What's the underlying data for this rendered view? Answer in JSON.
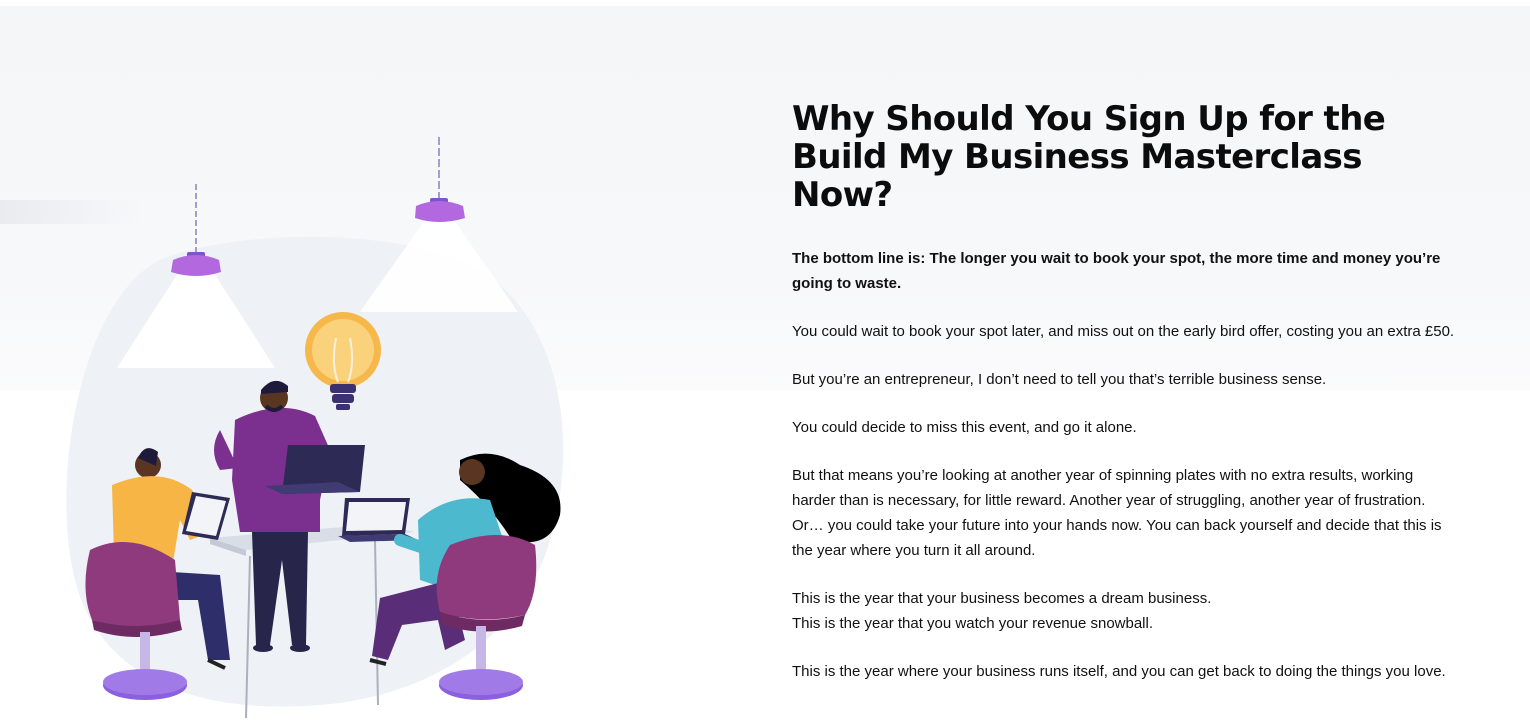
{
  "section": {
    "headline": "Why Should You Sign Up for the Build My Business Masterclass Now?",
    "paragraphs": [
      {
        "style": "bold",
        "lines": [
          "The bottom line is: The longer you wait to book your spot, the more time and money you’re going to waste."
        ]
      },
      {
        "style": "normal",
        "lines": [
          "You could wait to book your spot later, and miss out on the early bird offer, costing you an extra £50."
        ]
      },
      {
        "style": "normal",
        "lines": [
          "But you’re an entrepreneur, I don’t need to tell you that’s terrible business sense."
        ]
      },
      {
        "style": "normal",
        "lines": [
          "You could decide to miss this event, and go it alone."
        ]
      },
      {
        "style": "normal",
        "lines": [
          "But that means you’re looking at another year of spinning plates with no extra results, working harder than is necessary, for little reward. Another year of struggling, another year of frustration. Or… you could take your future into your hands now. You can back yourself and decide that this is the year where you turn it all around."
        ]
      },
      {
        "style": "normal",
        "lines": [
          "This is the year that your business becomes a dream business.",
          "This is the year that you watch your revenue snowball."
        ]
      },
      {
        "style": "normal",
        "lines": [
          "This is the year where your business runs itself, and you can get back to doing the things you love."
        ]
      }
    ]
  },
  "illustration": {
    "icons": [
      "ceiling-lamp-icon",
      "lightbulb-icon",
      "laptop-icon",
      "tablet-icon",
      "chair-icon"
    ],
    "colors": {
      "purple": "#7b2f8f",
      "chair": "#8e3a7d",
      "yellow": "#f6b544",
      "teal": "#4cb9cf",
      "navy": "#27264a",
      "lamp": "#b368e0",
      "bulb": "#f7b84b",
      "blob": "#eef1f5"
    }
  }
}
